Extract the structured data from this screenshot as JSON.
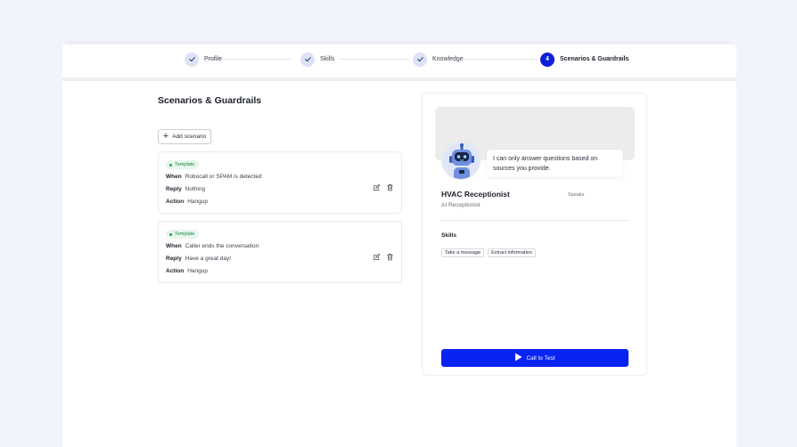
{
  "stepper": {
    "steps": [
      {
        "label": "Profile",
        "state": "complete",
        "icon": "check-icon"
      },
      {
        "label": "Skills",
        "state": "complete",
        "icon": "check-icon"
      },
      {
        "label": "Knowledge",
        "state": "complete",
        "icon": "check-icon"
      },
      {
        "label": "Scenarios & Guardrails",
        "state": "active",
        "number": "4"
      }
    ]
  },
  "main": {
    "title": "Scenarios & Guardrails",
    "add_button_label": "Add scenario",
    "scenarios": [
      {
        "badge": "Template",
        "when_label": "When",
        "when": "Robocall or SPAM is detected",
        "reply_label": "Reply",
        "reply": "Nothing",
        "action_label": "Action",
        "action": "Hangup"
      },
      {
        "badge": "Template",
        "when_label": "When",
        "when": "Caller ends the conversation",
        "reply_label": "Reply",
        "reply": "Have a great day!",
        "action_label": "Action",
        "action": "Hangup"
      }
    ]
  },
  "preview": {
    "bubble_text": "I can only answer questions based on sources you provide.",
    "agent_name": "HVAC Receptionist",
    "agent_role": "AI Receptionist",
    "speaks_label": "Speaks",
    "language_flag": "uk-flag-icon",
    "skills_title": "Skills",
    "skills": [
      "Take a message",
      "Extract information"
    ],
    "call_button_label": "Call to Test"
  },
  "colors": {
    "accent": "#0a23f5",
    "step_active": "#0e1fd8",
    "template_badge": "#22a45d"
  }
}
